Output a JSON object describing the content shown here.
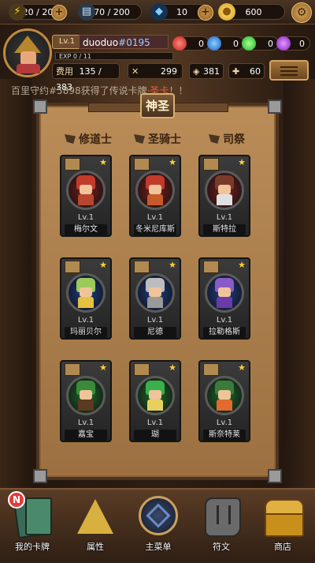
{
  "resources": {
    "stamina": "20 / 20",
    "energy": "70 / 200",
    "diamonds": "10",
    "gold": "600"
  },
  "player": {
    "level": "Lv.1",
    "name": "duoduo",
    "id": "#0195",
    "exp": "EXP  0 / 11",
    "gems": {
      "red": "0",
      "blue": "0",
      "green": "0",
      "purple": "0"
    }
  },
  "stats": {
    "cost_label": "费用",
    "cost_value": "135 / 383",
    "stat1": "299",
    "stat2": "381",
    "stat3": "60"
  },
  "ticker": {
    "prefix": "百里守约#5898获得了传说卡牌",
    "highlight": "·圣卡",
    "suffix": "！！"
  },
  "panel": {
    "title": "神圣",
    "classes": [
      "修道士",
      "圣骑士",
      "司祭"
    ]
  },
  "cards": [
    {
      "lv": "Lv.1",
      "name": "梅尔文",
      "hair": "#c23a2a",
      "orb": "#7a1d1d",
      "torso": "#b84530"
    },
    {
      "lv": "Lv.1",
      "name": "冬米尼库斯",
      "hair": "#c23a2a",
      "orb": "#7a1d1d",
      "torso": "#c65a2a"
    },
    {
      "lv": "Lv.1",
      "name": "斯特拉",
      "hair": "#7a3a2a",
      "orb": "#7a1d1d",
      "torso": "#e0e0e0"
    },
    {
      "lv": "Lv.1",
      "name": "玛丽贝尔",
      "hair": "#9acb5a",
      "orb": "#1d3f8a",
      "torso": "#e6c040"
    },
    {
      "lv": "Lv.1",
      "name": "尼德",
      "hair": "#bdbdbd",
      "orb": "#1d3f8a",
      "torso": "#9a9a9a"
    },
    {
      "lv": "Lv.1",
      "name": "拉勒格斯",
      "hair": "#8a5ac8",
      "orb": "#1d3f8a",
      "torso": "#6a3aa8"
    },
    {
      "lv": "Lv.1",
      "name": "嘉宝",
      "hair": "#3a8a3a",
      "orb": "#1f6a2a",
      "torso": "#5a3a20"
    },
    {
      "lv": "Lv.1",
      "name": "瑚",
      "hair": "#3ab04a",
      "orb": "#1f6a2a",
      "torso": "#e8d060"
    },
    {
      "lv": "Lv.1",
      "name": "斯奈特莱",
      "hair": "#3a7a3a",
      "orb": "#1f6a2a",
      "torso": "#e06a30"
    }
  ],
  "nav": {
    "badge": "N",
    "items": [
      "我的卡牌",
      "属性",
      "主菜单",
      "符文",
      "商店"
    ]
  },
  "colors": {
    "panel": "#b98c58",
    "accent_gold": "#ffcf3a",
    "highlight_red": "#ff6a3a"
  }
}
